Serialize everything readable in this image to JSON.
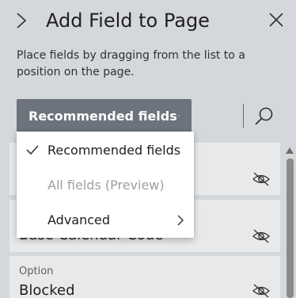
{
  "header": {
    "title": "Add Field to Page",
    "expand_icon": "chevron-right-icon",
    "close_icon": "close-icon"
  },
  "description": "Place fields by dragging from the list to a position on the page.",
  "toolbar": {
    "filter_label": "Recommended fields",
    "filter_icon": "chevron-down-icon",
    "search_icon": "search-icon",
    "accent_color": "#6c737c"
  },
  "menu": {
    "items": [
      {
        "label": "Recommended fields",
        "checked": true,
        "disabled": false
      },
      {
        "label": "All fields (Preview)",
        "checked": false,
        "disabled": true
      },
      {
        "label": "Advanced",
        "checked": false,
        "disabled": false,
        "has_submenu": true
      }
    ]
  },
  "fields": [
    {
      "type": "",
      "name": ""
    },
    {
      "type": "",
      "name": "Base Calendar Code"
    },
    {
      "type": "Option",
      "name": "Blocked"
    }
  ]
}
